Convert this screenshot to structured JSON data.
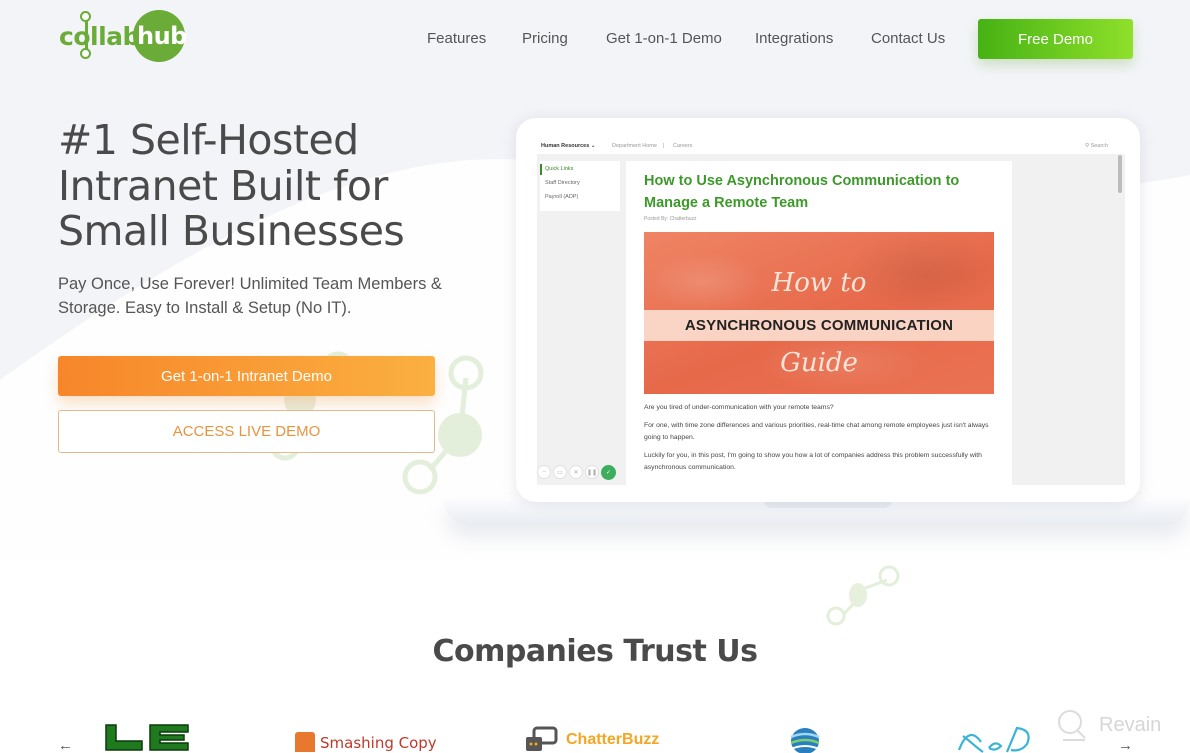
{
  "brand": {
    "name_part1": "collab",
    "name_part2": "hub",
    "brand_color": "#6aac37"
  },
  "nav": {
    "links": [
      "Features",
      "Pricing",
      "Get 1-on-1 Demo",
      "Integrations",
      "Contact Us"
    ],
    "cta_label": "Free Demo"
  },
  "hero": {
    "title_lines": [
      "#1 Self-Hosted",
      "Intranet Built for",
      "Small Businesses"
    ],
    "subtitle": "Pay Once, Use Forever! Unlimited Team Members & Storage. Easy to Install & Setup (No IT).",
    "primary_button": "Get 1-on-1 Intranet Demo",
    "secondary_button": "ACCESS LIVE DEMO",
    "accent_orange": "#f7862a"
  },
  "mockup": {
    "topbar": {
      "department": "Human Resources",
      "links": [
        "Department Home",
        "Careers"
      ],
      "search_label": "Search"
    },
    "sidebar": {
      "items": [
        "Quick Links",
        "Staff Directory",
        "Payroll (ADP)"
      ],
      "active_index": 0
    },
    "article": {
      "title": "How to Use Asynchronous Communication to Manage a Remote Team",
      "posted_by": "Posted By: Chatterbuzz",
      "image": {
        "script_top": "How to",
        "band_text": "ASYNCHRONOUS COMMUNICATION",
        "script_bottom": "Guide"
      },
      "paragraphs": [
        "Are you tired of under-communication with your remote teams?",
        "For one, with time zone differences and various priorities, real-time chat among remote employees just isn't always going to happen.",
        "Luckily for you, in this post, I'm going to show you how a lot of companies address this problem successfully with asynchronous communication."
      ]
    },
    "controls": [
      "minus-icon",
      "video-icon",
      "close-icon",
      "pause-icon",
      "check-icon"
    ]
  },
  "companies": {
    "title": "Companies Trust Us",
    "prev_arrow": "←",
    "next_arrow": "→",
    "logos": [
      "LE",
      "Smashing Copy",
      "ChatterBuzz",
      "Globe",
      "XeoDev"
    ]
  },
  "watermark": {
    "text": "Revain"
  }
}
